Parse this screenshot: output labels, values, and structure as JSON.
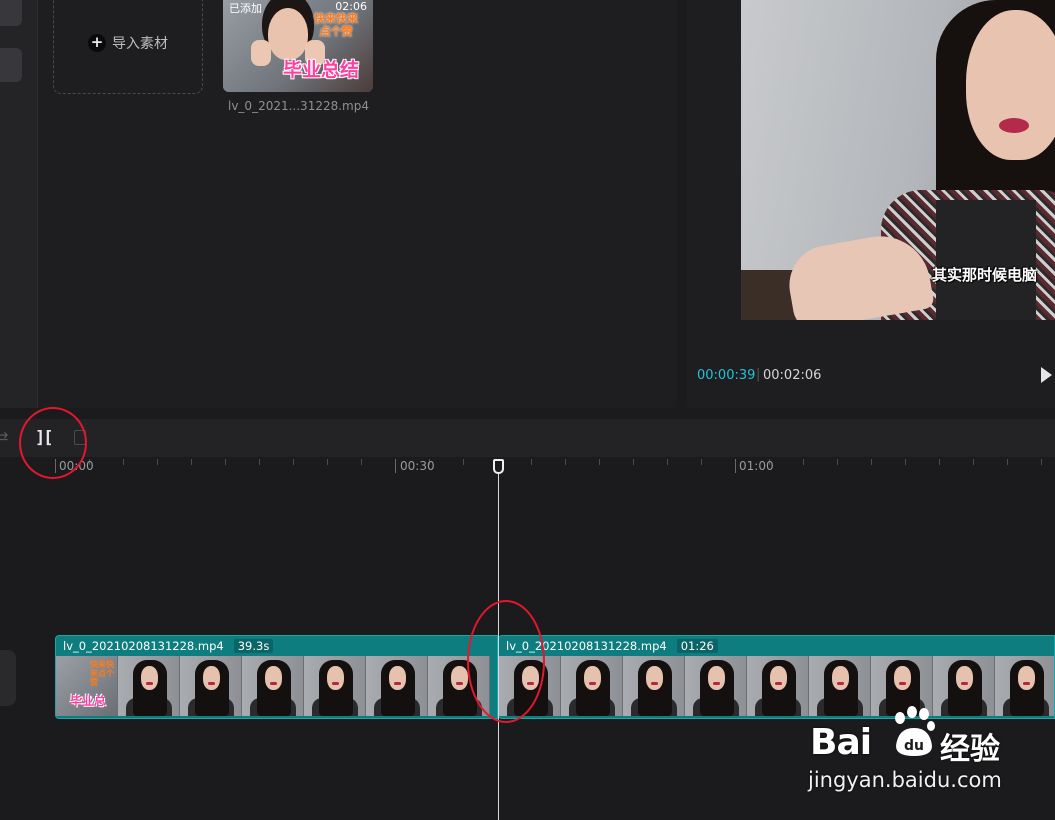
{
  "media": {
    "import_label": "导入素材",
    "clip": {
      "added_badge": "已添加",
      "duration": "02:06",
      "thumb_caption_top": "快来快来点个赞",
      "thumb_caption_bottom": "毕业总结",
      "filename": "lv_0_2021...31228.mp4"
    }
  },
  "preview": {
    "subtitle": "其实那时候电脑",
    "current_time": "00:00:39",
    "separator": "|",
    "total_time": "00:02:06"
  },
  "timeline": {
    "split_icon_glyph": "][",
    "ruler_labels": [
      "00:00",
      "00:30",
      "01:00"
    ],
    "clips": [
      {
        "name": "lv_0_20210208131228.mp4",
        "duration": "39.3s",
        "thumb_caption_top": "快来快来点个赞",
        "thumb_caption_bottom": "毕业总"
      },
      {
        "name": "lv_0_20210208131228.mp4",
        "duration": "01:26"
      }
    ]
  },
  "watermark": {
    "brand": "Bai",
    "paw_text": "du",
    "product": "经验",
    "url": "jingyan.baidu.com"
  },
  "colors": {
    "accent_time": "#22c3d6",
    "clip_track": "#0e7d7f",
    "annotation_ring": "#e3172d"
  }
}
